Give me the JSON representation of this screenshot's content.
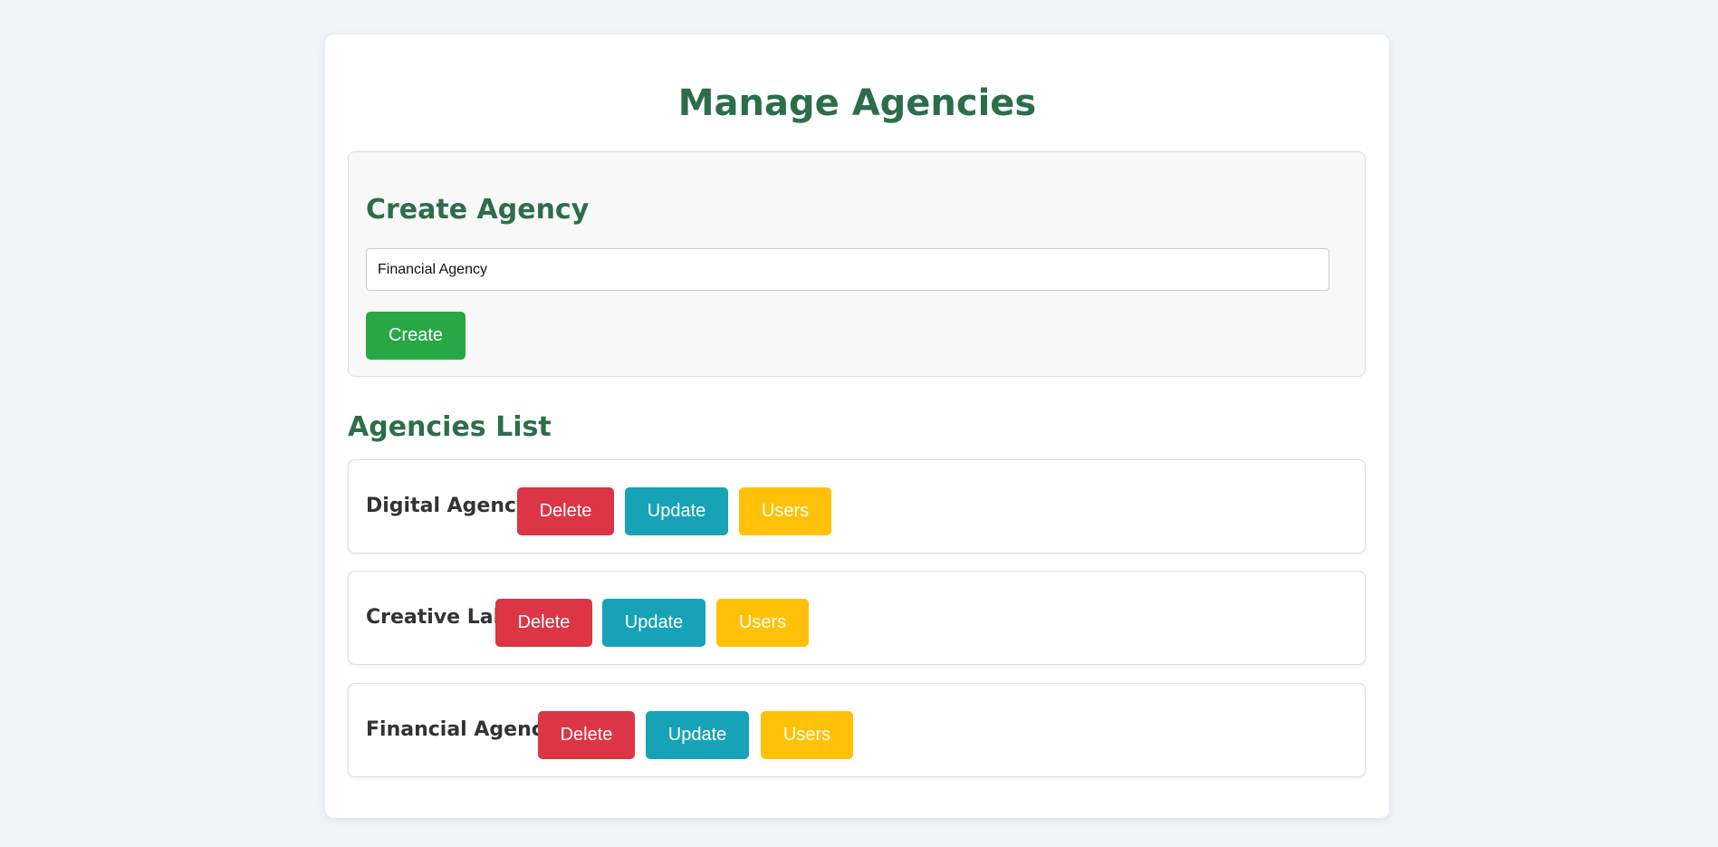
{
  "page": {
    "title": "Manage Agencies"
  },
  "create": {
    "heading": "Create Agency",
    "input_value": "Financial Agency",
    "button_label": "Create"
  },
  "list": {
    "heading": "Agencies List",
    "items": [
      {
        "name": "Digital Agency",
        "delete_label": "Delete",
        "update_label": "Update",
        "users_label": "Users"
      },
      {
        "name": "Creative Lab",
        "delete_label": "Delete",
        "update_label": "Update",
        "users_label": "Users"
      },
      {
        "name": "Financial Agency",
        "delete_label": "Delete",
        "update_label": "Update",
        "users_label": "Users"
      }
    ]
  },
  "colors": {
    "heading": "#2c6e49",
    "create": "#28a745",
    "delete": "#dc3545",
    "update": "#17a2b8",
    "users": "#ffc107"
  }
}
